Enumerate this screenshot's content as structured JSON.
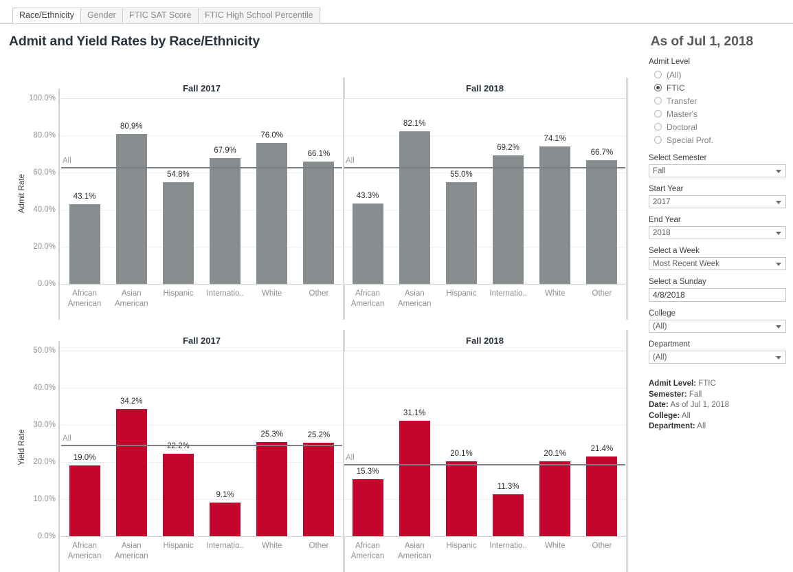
{
  "tabs": [
    {
      "label": "Race/Ethnicity",
      "active": true
    },
    {
      "label": "Gender",
      "active": false
    },
    {
      "label": "FTIC SAT Score",
      "active": false
    },
    {
      "label": "FTIC High School Percentile",
      "active": false
    }
  ],
  "header": {
    "title": "Admit and Yield Rates by Race/Ethnicity",
    "as_of": "As of Jul 1, 2018"
  },
  "sidebar": {
    "admit_level": {
      "label": "Admit Level",
      "options": [
        "(All)",
        "FTIC",
        "Transfer",
        "Master's",
        "Doctoral",
        "Special Prof."
      ],
      "selected": "FTIC"
    },
    "select_semester": {
      "label": "Select Semester",
      "value": "Fall"
    },
    "start_year": {
      "label": "Start Year",
      "value": "2017"
    },
    "end_year": {
      "label": "End Year",
      "value": "2018"
    },
    "select_week": {
      "label": "Select a Week",
      "value": "Most Recent Week"
    },
    "select_sunday": {
      "label": "Select a Sunday",
      "value": "4/8/2018"
    },
    "college": {
      "label": "College",
      "value": "(All)"
    },
    "department": {
      "label": "Department",
      "value": "(All)"
    },
    "summary": [
      {
        "key": "Admit Level:",
        "value": "FTIC"
      },
      {
        "key": "Semester:",
        "value": "Fall"
      },
      {
        "key": "Date:",
        "value": "As of Jul 1, 2018"
      },
      {
        "key": "College:",
        "value": "All"
      },
      {
        "key": "Department:",
        "value": "All"
      }
    ]
  },
  "colors": {
    "admit_bar": "#878c8f",
    "yield_bar": "#c4062f",
    "refline": "#7b7f83",
    "grid": "#eeeeee",
    "tab_active_text": "#444444",
    "title_text": "#29333d"
  },
  "chart_data": [
    {
      "type": "bar",
      "title": "Fall 2017",
      "ylabel": "Admit Rate",
      "xlabel": "",
      "categories": [
        "African American",
        "Asian American",
        "Hispanic",
        "Internatio..",
        "White",
        "Other"
      ],
      "values": [
        43.1,
        80.9,
        54.8,
        67.9,
        76.0,
        66.1
      ],
      "value_labels": [
        "43.1%",
        "80.9%",
        "54.8%",
        "67.9%",
        "76.0%",
        "66.1%"
      ],
      "ylim": [
        0,
        100
      ],
      "yticks": [
        0,
        20,
        40,
        60,
        80,
        100
      ],
      "ytick_labels": [
        "0.0%",
        "20.0%",
        "40.0%",
        "60.0%",
        "80.0%",
        "100.0%"
      ],
      "reference_line": {
        "label": "All",
        "value": 62.8
      },
      "bar_color": "#878c8f",
      "grid": true,
      "legend": "none"
    },
    {
      "type": "bar",
      "title": "Fall 2018",
      "ylabel": "Admit Rate",
      "xlabel": "",
      "categories": [
        "African American",
        "Asian American",
        "Hispanic",
        "Internatio..",
        "White",
        "Other"
      ],
      "values": [
        43.3,
        82.1,
        55.0,
        69.2,
        74.1,
        66.7
      ],
      "value_labels": [
        "43.3%",
        "82.1%",
        "55.0%",
        "69.2%",
        "74.1%",
        "66.7%"
      ],
      "ylim": [
        0,
        100
      ],
      "yticks": [
        0,
        20,
        40,
        60,
        80,
        100
      ],
      "ytick_labels": [
        "0.0%",
        "20.0%",
        "40.0%",
        "60.0%",
        "80.0%",
        "100.0%"
      ],
      "reference_line": {
        "label": "All",
        "value": 62.8
      },
      "bar_color": "#878c8f",
      "grid": true,
      "legend": "none"
    },
    {
      "type": "bar",
      "title": "Fall 2017",
      "ylabel": "Yield Rate",
      "xlabel": "",
      "categories": [
        "African American",
        "Asian American",
        "Hispanic",
        "Internatio..",
        "White",
        "Other"
      ],
      "values": [
        19.0,
        34.2,
        22.2,
        9.1,
        25.3,
        25.2
      ],
      "value_labels": [
        "19.0%",
        "34.2%",
        "22.2%",
        "9.1%",
        "25.3%",
        "25.2%"
      ],
      "ylim": [
        0,
        50
      ],
      "yticks": [
        0,
        10,
        20,
        30,
        40,
        50
      ],
      "ytick_labels": [
        "0.0%",
        "10.0%",
        "20.0%",
        "30.0%",
        "40.0%",
        "50.0%"
      ],
      "reference_line": {
        "label": "All",
        "value": 24.7
      },
      "bar_color": "#c4062f",
      "grid": true,
      "legend": "none"
    },
    {
      "type": "bar",
      "title": "Fall 2018",
      "ylabel": "Yield Rate",
      "xlabel": "",
      "categories": [
        "African American",
        "Asian American",
        "Hispanic",
        "Internatio..",
        "White",
        "Other"
      ],
      "values": [
        15.3,
        31.1,
        20.1,
        11.3,
        20.1,
        21.4
      ],
      "value_labels": [
        "15.3%",
        "31.1%",
        "20.1%",
        "11.3%",
        "20.1%",
        "21.4%"
      ],
      "ylim": [
        0,
        50
      ],
      "yticks": [
        0,
        10,
        20,
        30,
        40,
        50
      ],
      "ytick_labels": [
        "0.0%",
        "10.0%",
        "20.0%",
        "30.0%",
        "40.0%",
        "50.0%"
      ],
      "reference_line": {
        "label": "All",
        "value": 19.4
      },
      "bar_color": "#c4062f",
      "grid": true,
      "legend": "none"
    }
  ]
}
